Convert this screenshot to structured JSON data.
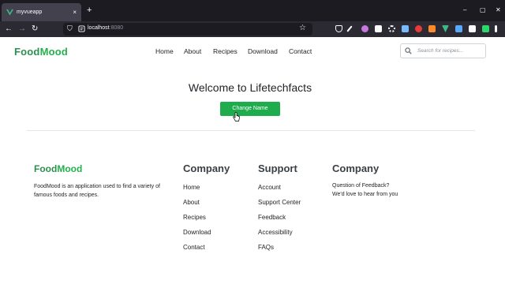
{
  "browser": {
    "tab_title": "myvueapp",
    "tab_close": "×",
    "new_tab": "+",
    "url_host": "localhost",
    "url_port": ":8080",
    "window_controls": {
      "minimize": "–",
      "maximize": "▢",
      "close": "✕"
    },
    "nav": {
      "back": "←",
      "forward": "→",
      "reload": "↻",
      "star": "☆"
    }
  },
  "header": {
    "logo_part1": "Food",
    "logo_part2": "Mood",
    "nav": [
      "Home",
      "About",
      "Recipes",
      "Download",
      "Contact"
    ],
    "search_placeholder": "Search for recipes..."
  },
  "hero": {
    "title": "Welcome to Lifetechfacts",
    "button_label": "Change Name"
  },
  "footer": {
    "logo_part1": "Food",
    "logo_part2": "Mood",
    "description": "FoodMood is an application used to find a variety of famous foods and recipes.",
    "columns": [
      {
        "heading": "Company",
        "links": [
          "Home",
          "About",
          "Recipes",
          "Download",
          "Contact"
        ]
      },
      {
        "heading": "Support",
        "links": [
          "Account",
          "Support Center",
          "Feedback",
          "Accessibility",
          "FAQs"
        ]
      },
      {
        "heading": "Company",
        "lines": [
          "Question of Feedback?",
          "We'd love to hear from you"
        ]
      }
    ]
  },
  "colors": {
    "brand_dark": "#2d8f4e",
    "brand_light": "#22b14c",
    "button": "#1eac4d",
    "chrome_bg": "#1c1b22",
    "toolbar_bg": "#2b2a33"
  }
}
